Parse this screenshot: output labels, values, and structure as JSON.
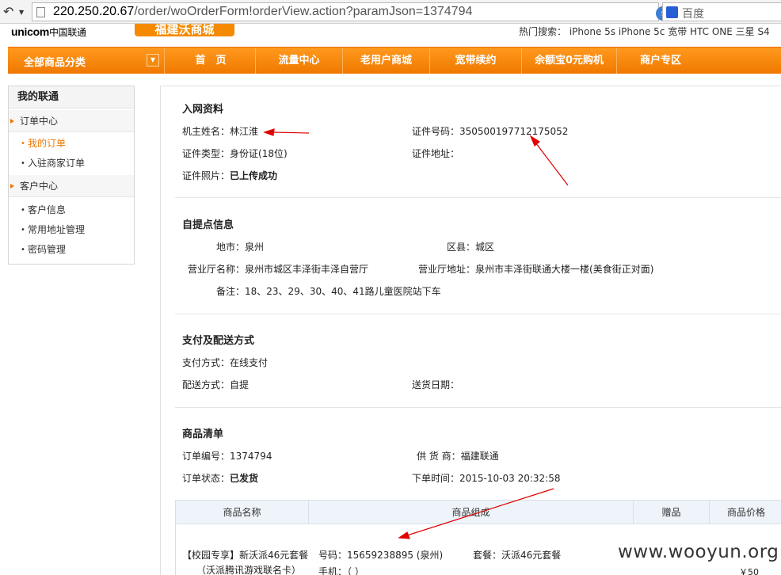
{
  "browser": {
    "url_prefix": "220.250.20.67",
    "url_path": "/order/woOrderForm!orderView.action?paramJson=1374794",
    "search_placeholder": "百度"
  },
  "header": {
    "logo_en": "unicom",
    "logo_cn": "中国联通",
    "mall_title": "福建沃商城",
    "hot_search": "热门搜索： iPhone 5s  iPhone 5c  宽带  HTC ONE  三星 S4"
  },
  "nav": {
    "category_label": "全部商品分类",
    "items": [
      "首　页",
      "流量中心",
      "老用户商城",
      "宽带续约",
      "余额宝0元购机",
      "商户专区"
    ]
  },
  "sidebar": {
    "title": "我的联通",
    "order_center": "订单中心",
    "my_orders": "我的订单",
    "merchant_orders": "入驻商家订单",
    "customer_center": "客户中心",
    "customer_info": "客户信息",
    "address_mgmt": "常用地址管理",
    "password_mgmt": "密码管理"
  },
  "registration": {
    "title": "入网资料",
    "owner_label": "机主姓名：",
    "owner_value": "林江淮",
    "id_no_label": "证件号码：",
    "id_no_value": "350500197712175052",
    "id_type_label": "证件类型：",
    "id_type_value": "身份证(18位)",
    "id_addr_label": "证件地址：",
    "id_addr_value": "",
    "photo_label": "证件照片：",
    "photo_value": "已上传成功"
  },
  "pickup": {
    "title": "自提点信息",
    "city_label": "地市：",
    "city_value": "泉州",
    "district_label": "区县：",
    "district_value": "城区",
    "hall_name_label": "营业厅名称：",
    "hall_name_value": "泉州市城区丰泽街丰泽自营厅",
    "hall_addr_label": "营业厅地址：",
    "hall_addr_value": "泉州市丰泽街联通大楼一楼(美食街正对面)",
    "note_label": "备注：",
    "note_value": "18、23、29、30、40、41路儿童医院站下车"
  },
  "payment": {
    "title": "支付及配送方式",
    "pay_label": "支付方式：",
    "pay_value": "在线支付",
    "delivery_label": "配送方式：",
    "delivery_value": "自提",
    "delivery_date_label": "送货日期：",
    "delivery_date_value": ""
  },
  "products": {
    "title": "商品清单",
    "order_no_label": "订单编号：",
    "order_no_value": "1374794",
    "supplier_label": "供 货 商：",
    "supplier_value": "福建联通",
    "status_label": "订单状态：",
    "status_value": "已发货",
    "order_time_label": "下单时间：",
    "order_time_value": "2015-10-03 20:32:58",
    "columns": [
      "商品名称",
      "商品组成",
      "赠品",
      "商品价格"
    ],
    "row": {
      "name_line1": "【校园专享】新沃派46元套餐",
      "name_line2": "（沃派腾讯游戏联名卡）",
      "number": "号码：15659238895 (泉州)",
      "plan": "套餐：沃派46元套餐",
      "phone": "手机：（ ）",
      "price": "￥50"
    }
  },
  "watermark": "www.wooyun.org",
  "colors": {
    "nav_orange": "#f58a00",
    "active_link": "#f07800",
    "annotation_arrow": "#e00000"
  }
}
